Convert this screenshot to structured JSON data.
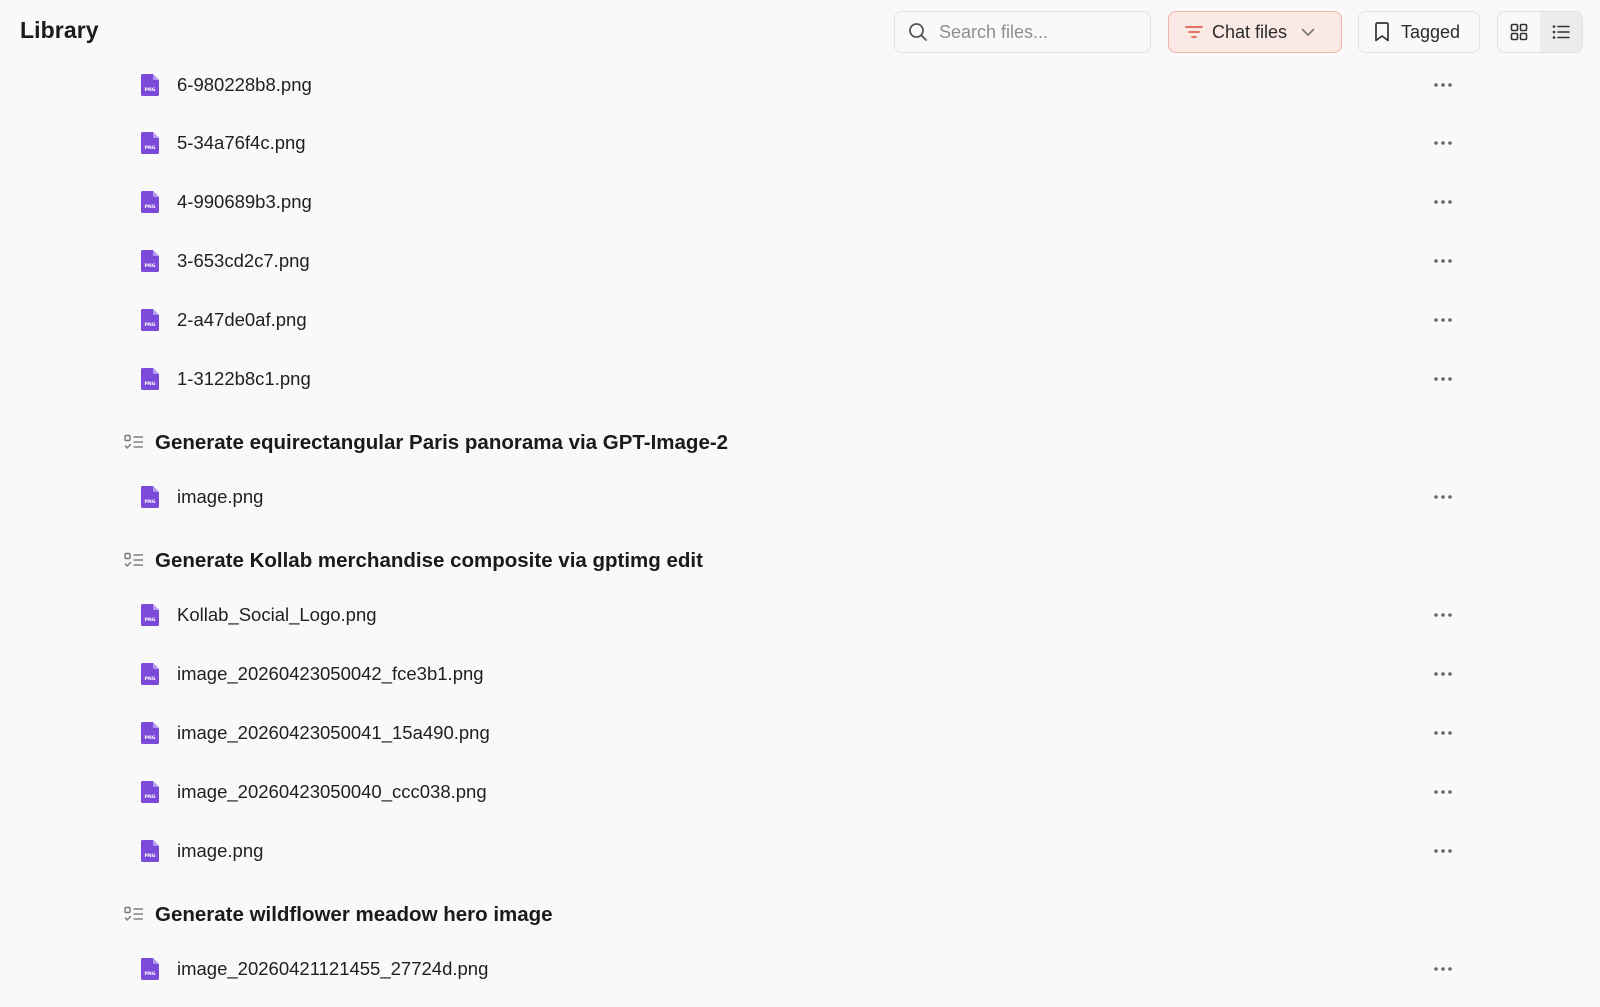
{
  "header": {
    "title": "Library",
    "search_placeholder": "Search files...",
    "filter_label": "Chat files",
    "tagged_label": "Tagged"
  },
  "colors": {
    "file_icon": "#7c4ad9",
    "filter_bg": "#fbe9e6",
    "filter_border": "#f1b1a8",
    "filter_icon": "#e0614e"
  },
  "icons": {
    "search": "search-icon",
    "filter": "filter-icon",
    "chevron": "chevron-down-icon",
    "bookmark": "bookmark-icon",
    "grid": "grid-view-icon",
    "list": "list-view-icon",
    "file": "png-file-icon",
    "group": "checklist-icon",
    "more": "more-horizontal-icon"
  },
  "file_icon_text": "PNG",
  "files_top": [
    "6-980228b8.png",
    "5-34a76f4c.png",
    "4-990689b3.png",
    "3-653cd2c7.png",
    "2-a47de0af.png",
    "1-3122b8c1.png"
  ],
  "groups": [
    {
      "title": "Generate equirectangular Paris panorama via GPT-Image-2",
      "files": [
        "image.png"
      ]
    },
    {
      "title": "Generate Kollab merchandise composite via gptimg edit",
      "files": [
        "Kollab_Social_Logo.png",
        "image_20260423050042_fce3b1.png",
        "image_20260423050041_15a490.png",
        "image_20260423050040_ccc038.png",
        "image.png"
      ]
    },
    {
      "title": "Generate wildflower meadow hero image",
      "files": [
        "image_20260421121455_27724d.png"
      ]
    }
  ]
}
